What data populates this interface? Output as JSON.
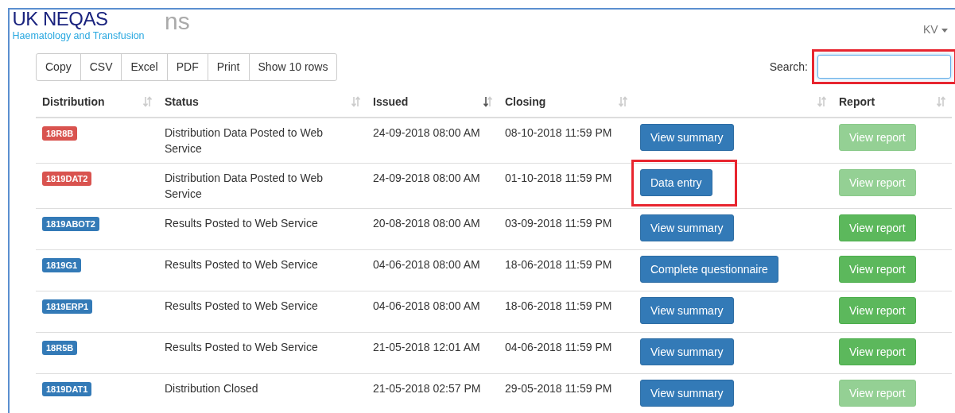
{
  "brand": {
    "name": "UK NEQAS",
    "subtitle": "Haematology and Transfusion"
  },
  "heading_fragment": "ns",
  "user_menu": {
    "label": "KV"
  },
  "export_buttons": [
    "Copy",
    "CSV",
    "Excel",
    "PDF",
    "Print",
    "Show 10 rows"
  ],
  "search": {
    "label": "Search:",
    "highlighted": true
  },
  "table": {
    "columns": [
      {
        "label": "Distribution",
        "sorted": false
      },
      {
        "label": "Status",
        "sorted": false
      },
      {
        "label": "Issued",
        "sorted": true
      },
      {
        "label": "Closing",
        "sorted": false
      },
      {
        "sorted": false
      },
      {
        "label": "Report",
        "sorted": false
      }
    ],
    "rows": [
      {
        "distribution": "18R8B",
        "color": "#d9534f",
        "status": "Distribution Data Posted to Web Service",
        "issued": "24-09-2018 08:00 AM",
        "closing": "08-10-2018 11:59 PM",
        "action": "View summary",
        "action_highlighted": false,
        "report": "View report",
        "report_disabled": true
      },
      {
        "distribution": "1819DAT2",
        "color": "#d9534f",
        "status": "Distribution Data Posted to Web Service",
        "issued": "24-09-2018 08:00 AM",
        "closing": "01-10-2018 11:59 PM",
        "action": "Data entry",
        "action_highlighted": true,
        "report": "View report",
        "report_disabled": true
      },
      {
        "distribution": "1819ABOT2",
        "color": "#337ab7",
        "status": "Results Posted to Web Service",
        "issued": "20-08-2018 08:00 AM",
        "closing": "03-09-2018 11:59 PM",
        "action": "View summary",
        "action_highlighted": false,
        "report": "View report",
        "report_disabled": false
      },
      {
        "distribution": "1819G1",
        "color": "#337ab7",
        "status": "Results Posted to Web Service",
        "issued": "04-06-2018 08:00 AM",
        "closing": "18-06-2018 11:59 PM",
        "action": "Complete questionnaire",
        "action_highlighted": false,
        "report": "View report",
        "report_disabled": false
      },
      {
        "distribution": "1819ERP1",
        "color": "#337ab7",
        "status": "Results Posted to Web Service",
        "issued": "04-06-2018 08:00 AM",
        "closing": "18-06-2018 11:59 PM",
        "action": "View summary",
        "action_highlighted": false,
        "report": "View report",
        "report_disabled": false
      },
      {
        "distribution": "18R5B",
        "color": "#337ab7",
        "status": "Results Posted to Web Service",
        "issued": "21-05-2018 12:01 AM",
        "closing": "04-06-2018 11:59 PM",
        "action": "View summary",
        "action_highlighted": false,
        "report": "View report",
        "report_disabled": false
      },
      {
        "distribution": "1819DAT1",
        "color": "#337ab7",
        "status": "Distribution Closed",
        "issued": "21-05-2018 02:57 PM",
        "closing": "29-05-2018 11:59 PM",
        "action": "View summary",
        "action_highlighted": false,
        "report": "View report",
        "report_disabled": true
      }
    ]
  }
}
